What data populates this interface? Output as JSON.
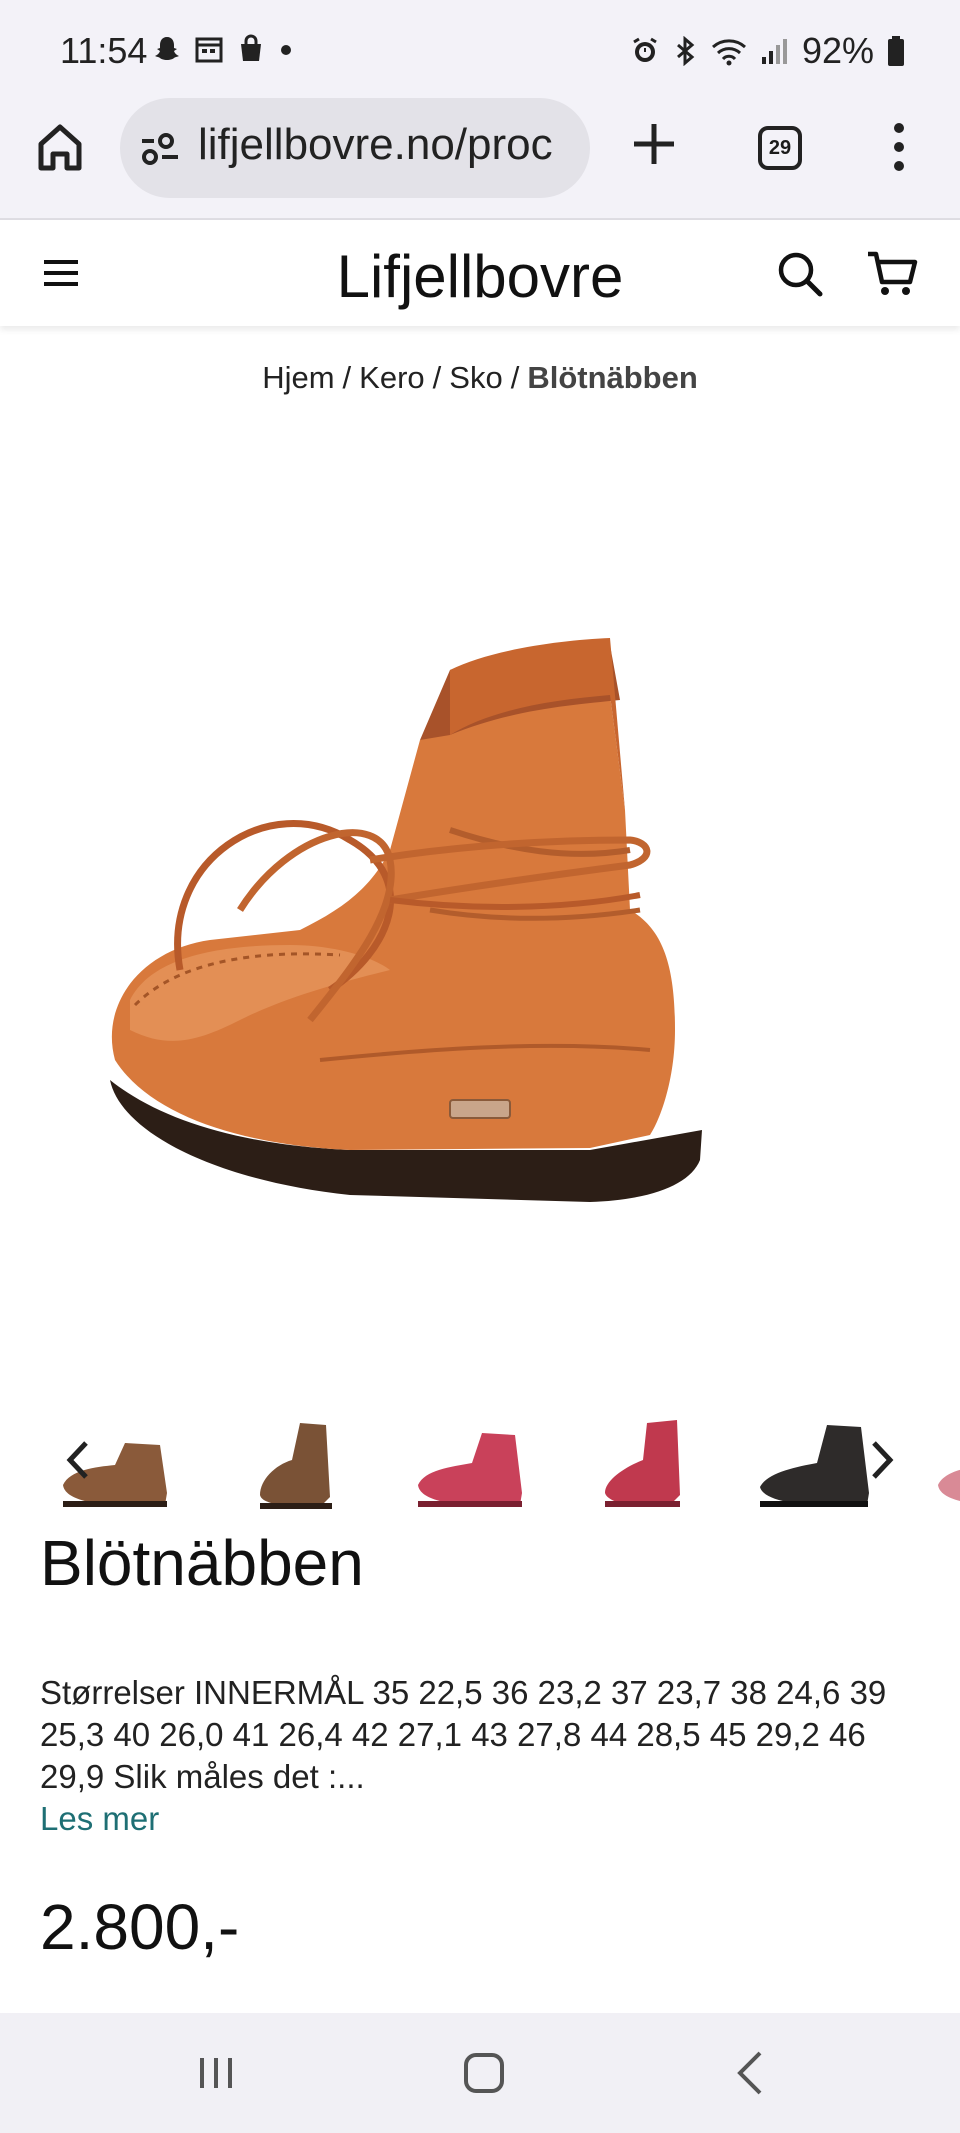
{
  "status_bar": {
    "time": "11:54",
    "battery": "92%"
  },
  "browser": {
    "url": "lifjellbovre.no/proc",
    "tab_count": "29"
  },
  "site": {
    "logo": "Lifjellbovre"
  },
  "breadcrumb": {
    "items": [
      "Hjem",
      "Kero",
      "Sko"
    ],
    "separator": "/",
    "current": "Blötnäbben"
  },
  "product": {
    "title": "Blötnäbben",
    "description": "Størrelser INNERMÅL     35 22,5 36 23,2 37 23,7 38 24,6 39 25,3 40 26,0 41 26,4 42 27,1 43 27,8 44 28,5 45 29,2 46 29,9 Slik måles det :...",
    "read_more": "Les mer",
    "price": "2.800,-"
  },
  "thumbnails": [
    {
      "color": "#8a5a3a"
    },
    {
      "color": "#7a5236"
    },
    {
      "color": "#c9415a"
    },
    {
      "color": "#c0394e"
    },
    {
      "color": "#2e2b2a"
    },
    {
      "color": "#d98a96"
    }
  ],
  "colors": {
    "accent_link": "#1e6f74",
    "boot_leather": "#d8793c",
    "sole": "#2c1e16"
  },
  "icons": {
    "status_left": [
      "snapchat-icon",
      "calendar-icon",
      "shopping-bag-icon",
      "dot-icon"
    ],
    "status_right": [
      "alarm-icon",
      "bluetooth-icon",
      "wifi-icon",
      "signal-icon",
      "battery-icon"
    ]
  }
}
